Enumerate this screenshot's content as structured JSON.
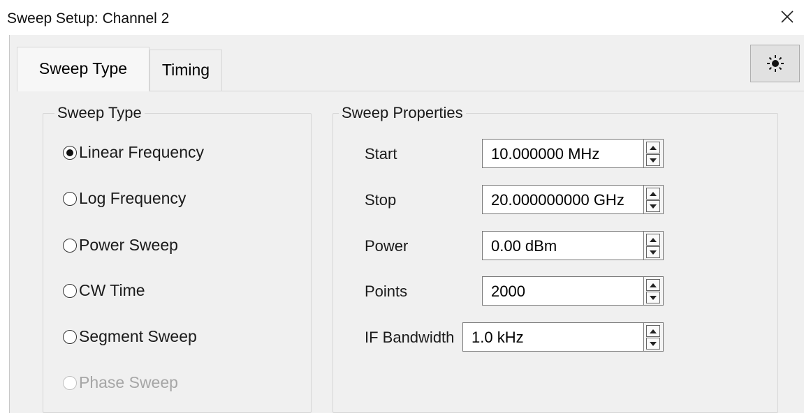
{
  "window": {
    "title": "Sweep Setup: Channel 2"
  },
  "tabs": [
    {
      "label": "Sweep Type",
      "active": true
    },
    {
      "label": "Timing",
      "active": false
    }
  ],
  "toolbar": {
    "brightness_icon": "sun-icon"
  },
  "sweep_type": {
    "title": "Sweep Type",
    "options": [
      {
        "label": "Linear Frequency",
        "selected": true,
        "enabled": true
      },
      {
        "label": "Log Frequency",
        "selected": false,
        "enabled": true
      },
      {
        "label": "Power Sweep",
        "selected": false,
        "enabled": true
      },
      {
        "label": "CW Time",
        "selected": false,
        "enabled": true
      },
      {
        "label": "Segment Sweep",
        "selected": false,
        "enabled": true
      },
      {
        "label": "Phase Sweep",
        "selected": false,
        "enabled": false
      }
    ]
  },
  "sweep_properties": {
    "title": "Sweep Properties",
    "fields": [
      {
        "label": "Start",
        "value": "10.000000 MHz"
      },
      {
        "label": "Stop",
        "value": "20.000000000 GHz"
      },
      {
        "label": "Power",
        "value": "0.00 dBm"
      },
      {
        "label": "Points",
        "value": "2000"
      },
      {
        "label": "IF Bandwidth",
        "value": "1.0 kHz"
      }
    ]
  }
}
